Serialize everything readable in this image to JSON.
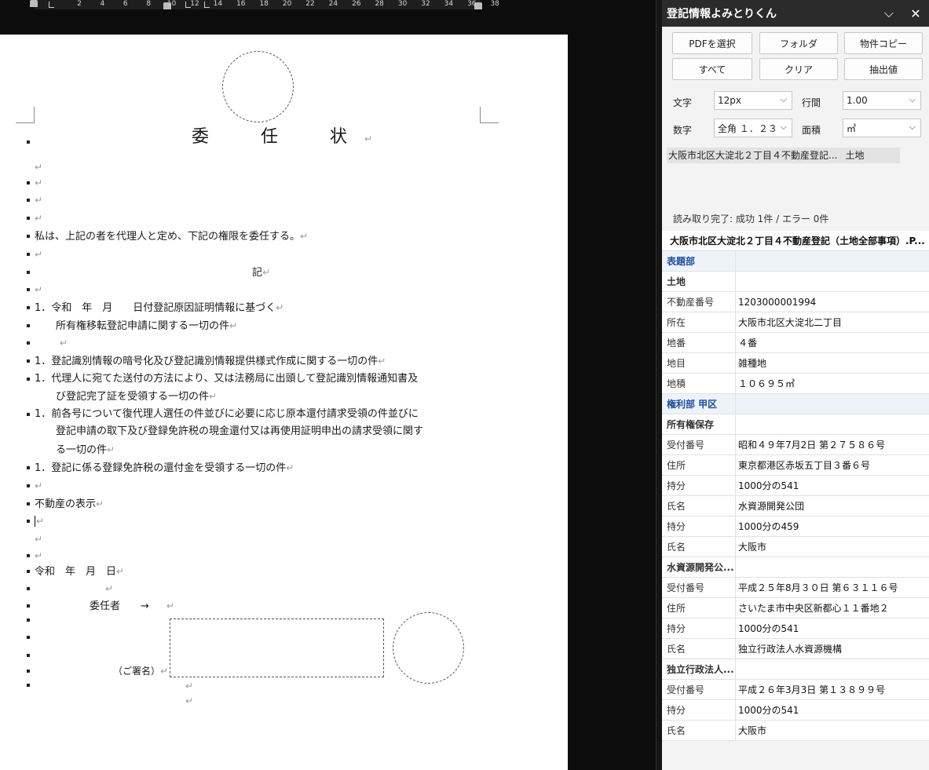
{
  "ruler": {
    "ticks": [
      "2",
      "4",
      "6",
      "8",
      "10",
      "12",
      "14",
      "16",
      "18",
      "20",
      "22",
      "24",
      "26",
      "28",
      "30",
      "32",
      "34",
      "36",
      "38"
    ]
  },
  "document": {
    "title": "委　任　状",
    "lines": {
      "l5": "私は、上記の者を代理人と定め、下記の権限を委任する。",
      "l7": "記",
      "l9": "1．令和　年　月　　日付登記原因証明情報に基づく",
      "l10": "　所有権移転登記申請に関する一切の件",
      "l12": "1．登記識別情報の暗号化及び登記識別情報提供様式作成に関する一切の件",
      "l13a": "1．代理人に宛てた送付の方法により、又は法務局に出頭して登記識別情報通知書及",
      "l13b": "　び登記完了証を受領する一切の件",
      "l14a": "1．前各号について復代理人選任の件並びに必要に応じ原本還付請求受領の件並びに",
      "l14b": "　登記申請の取下及び登録免許税の現金還付又は再使用証明申出の請求受領に関す",
      "l14c": "　る一切の件",
      "l15": "1．登記に係る登録免許税の還付金を受領する一切の件",
      "l17": "不動産の表示",
      "l20": "令和　年　月　日",
      "l22": "委任者　　→",
      "l25": "（ご署名）"
    },
    "pilcrow": "↵"
  },
  "panel": {
    "title": "登記情報よみとりくん",
    "buttons": {
      "select_pdf": "PDFを選択",
      "folder": "フォルダ",
      "copy_property": "物件コピー",
      "all": "すべて",
      "clear": "クリア",
      "extract": "抽出値"
    },
    "settings": {
      "font_label": "文字",
      "font_value": "12px",
      "line_label": "行間",
      "line_value": "1.00",
      "digit_label": "数字",
      "digit_value": "全角 １．２３",
      "area_label": "面積",
      "area_value": "㎡"
    },
    "file": {
      "name": "大阪市北区大淀北２丁目４不動産登記...",
      "kind": "土地"
    },
    "status": "読み取り完了: 成功 1件 / エラー 0件",
    "table": {
      "title": "大阪市北区大淀北２丁目４不動産登記（土地全部事項）.P...",
      "rows": [
        {
          "key": "表題部",
          "value": "",
          "kind": "section"
        },
        {
          "key": "土地",
          "value": "",
          "kind": "group"
        },
        {
          "key": "不動産番号",
          "value": "1203000001994",
          "kind": "row"
        },
        {
          "key": "所在",
          "value": "大阪市北区大淀北二丁目",
          "kind": "row"
        },
        {
          "key": "地番",
          "value": "４番",
          "kind": "row"
        },
        {
          "key": "地目",
          "value": "雑種地",
          "kind": "row"
        },
        {
          "key": "地積",
          "value": "１０６９５㎡",
          "kind": "row"
        },
        {
          "key": "権利部 甲区",
          "value": "",
          "kind": "section"
        },
        {
          "key": "所有権保存",
          "value": "",
          "kind": "group"
        },
        {
          "key": "受付番号",
          "value": "昭和４９年7月2日 第２７５８６号",
          "kind": "row"
        },
        {
          "key": "住所",
          "value": "東京都港区赤坂五丁目３番６号",
          "kind": "row"
        },
        {
          "key": "持分",
          "value": "1000分の541",
          "kind": "row"
        },
        {
          "key": "氏名",
          "value": "水資源開発公団",
          "kind": "row"
        },
        {
          "key": "持分",
          "value": "1000分の459",
          "kind": "row"
        },
        {
          "key": "氏名",
          "value": "大阪市",
          "kind": "row"
        },
        {
          "key": "水資源開発公...",
          "value": "",
          "kind": "group"
        },
        {
          "key": "受付番号",
          "value": "平成２５年8月３０日 第６３１１６号",
          "kind": "row"
        },
        {
          "key": "住所",
          "value": "さいたま市中央区新都心１１番地２",
          "kind": "row"
        },
        {
          "key": "持分",
          "value": "1000分の541",
          "kind": "row"
        },
        {
          "key": "氏名",
          "value": "独立行政法人水資源機構",
          "kind": "row"
        },
        {
          "key": "独立行政法人...",
          "value": "",
          "kind": "group"
        },
        {
          "key": "受付番号",
          "value": "平成２６年3月3日 第１３８９９号",
          "kind": "row"
        },
        {
          "key": "持分",
          "value": "1000分の541",
          "kind": "row"
        },
        {
          "key": "氏名",
          "value": "大阪市",
          "kind": "row"
        }
      ]
    }
  }
}
